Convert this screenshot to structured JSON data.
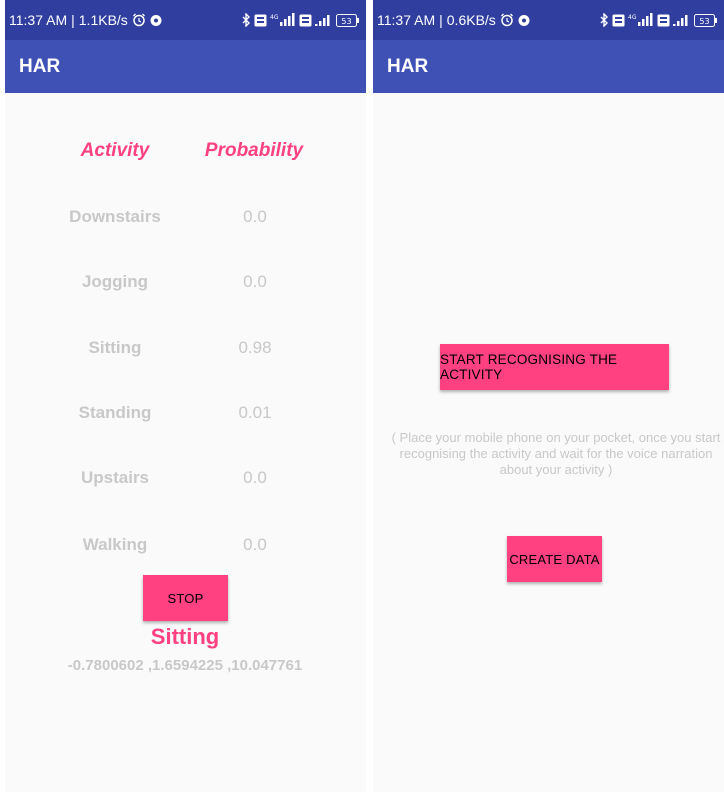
{
  "left_screen": {
    "status": {
      "time": "11:37 AM",
      "separator": "|",
      "speed": "1.1KB/s"
    },
    "app_title": "HAR",
    "headers": {
      "activity": "Activity",
      "probability": "Probability"
    },
    "rows": [
      {
        "label": "Downstairs",
        "value": "0.0"
      },
      {
        "label": "Jogging",
        "value": "0.0"
      },
      {
        "label": "Sitting",
        "value": "0.98"
      },
      {
        "label": "Standing",
        "value": "0.01"
      },
      {
        "label": "Upstairs",
        "value": "0.0"
      },
      {
        "label": "Walking",
        "value": "0.0"
      }
    ],
    "stop_label": "STOP",
    "detected_activity": "Sitting",
    "sensor_values": "-0.7800602 ,1.6594225 ,10.047761"
  },
  "right_screen": {
    "status": {
      "time": "11:37 AM",
      "separator": "|",
      "speed": "0.6KB/s"
    },
    "app_title": "HAR",
    "start_label": "START RECOGNISING THE ACTIVITY",
    "instruction": "( Place your mobile phone on your pocket, once you start recognising the activity and wait for the voice narration about your activity )",
    "create_label": "CREATE DATA"
  },
  "status_icons": [
    "alarm-icon",
    "shield-icon",
    "bluetooth-icon",
    "volte-icon",
    "4g-signal-icon",
    "volte-icon",
    "signal-icon",
    "battery-icon"
  ],
  "battery": "53",
  "network": "4G",
  "colors": {
    "status_bar": "#303f9f",
    "app_bar": "#3f51b5",
    "accent": "#ff4081",
    "muted_text": "#c8c8c8",
    "background": "#fafafa"
  }
}
